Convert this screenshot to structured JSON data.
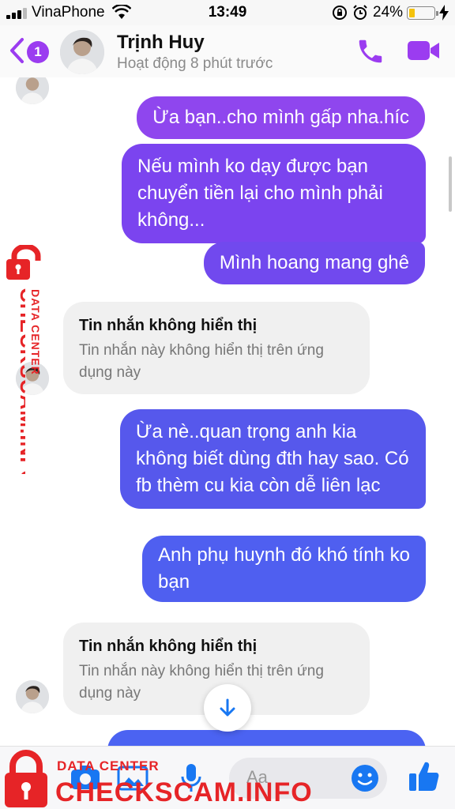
{
  "status_bar": {
    "carrier": "VinaPhone",
    "time": "13:49",
    "battery_percent": "24%",
    "battery_level": 0.24
  },
  "header": {
    "unread_count": "1",
    "contact_name": "Trịnh Huy",
    "contact_status": "Hoạt động 8 phút trước",
    "accent_color": "#9b3cf0"
  },
  "messages": [
    {
      "sender": "me",
      "text": "Ừa bạn..cho mình gấp nha.híc"
    },
    {
      "sender": "me",
      "text": "Nếu mình ko dạy được bạn chuyển tiền lại cho mình phải không..."
    },
    {
      "sender": "me",
      "text": "Mình hoang mang ghê"
    },
    {
      "sender": "them",
      "title": "Tin nhắn không hiển thị",
      "text": "Tin nhắn này không hiển thị trên ứng dụng này"
    },
    {
      "sender": "me",
      "text": "Ừa nè..quan trọng anh kia không biết dùng đth hay sao. Có fb thèm cu kia còn dễ liên lạc"
    },
    {
      "sender": "me",
      "text": "Anh phụ huynh đó khó tính ko bạn"
    },
    {
      "sender": "them",
      "title": "Tin nhắn không hiển thị",
      "text": "Tin nhắn này không hiển thị trên ứng dụng này"
    }
  ],
  "composer": {
    "placeholder": "Aa"
  },
  "watermark": {
    "label": "DATA CENTER",
    "brand": "CHECKSCAM.INFO",
    "color": "#e62427"
  },
  "icons": [
    "back-icon",
    "phone-icon",
    "video-camera-icon",
    "chevron-down-icon",
    "camera-icon",
    "gallery-icon",
    "microphone-icon",
    "emoji-icon",
    "thumbs-up-icon",
    "lock-icon"
  ]
}
